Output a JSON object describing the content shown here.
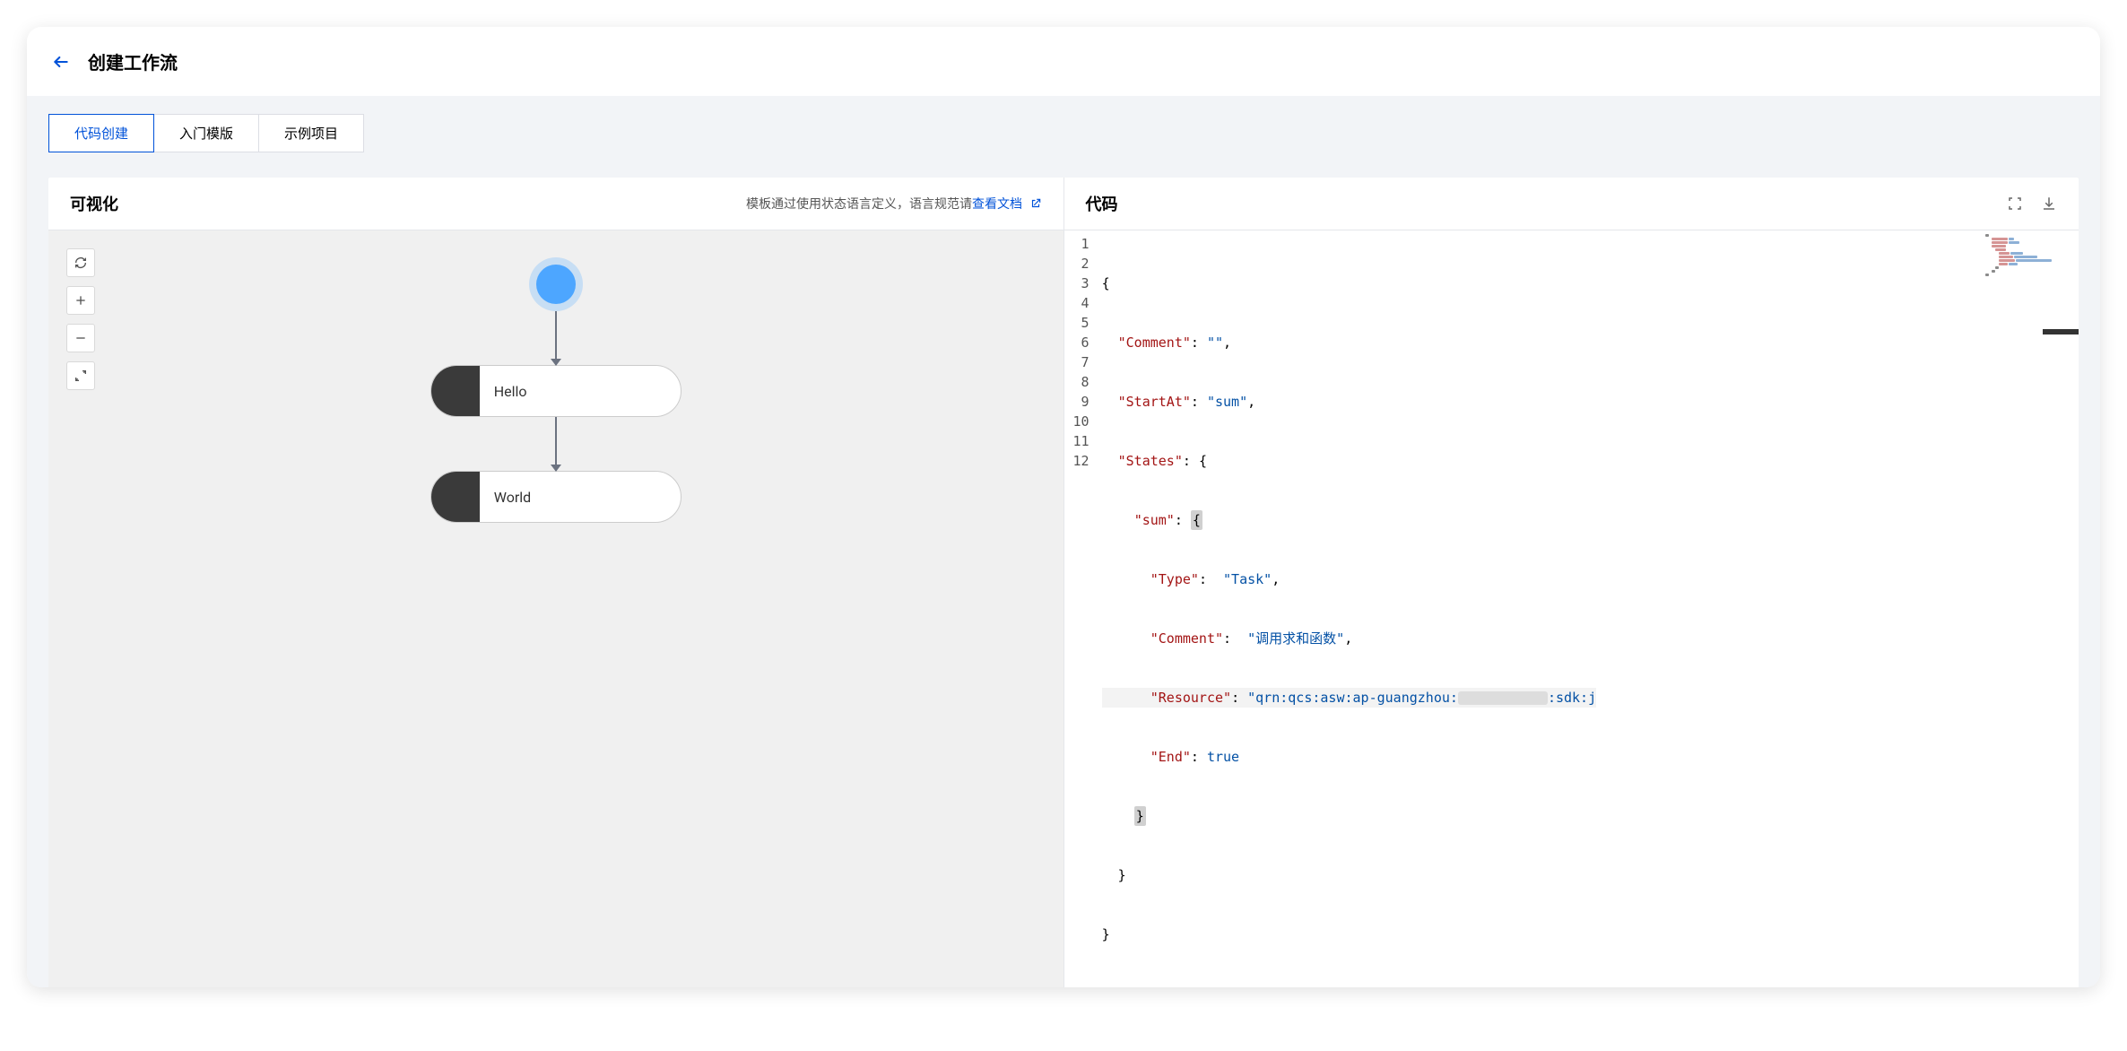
{
  "header": {
    "title": "创建工作流"
  },
  "tabs": [
    {
      "label": "代码创建",
      "active": true
    },
    {
      "label": "入门模版",
      "active": false
    },
    {
      "label": "示例项目",
      "active": false
    }
  ],
  "viz": {
    "title": "可视化",
    "note_prefix": "模板通过使用状态语言定义，语言规范请",
    "note_link": "查看文档",
    "nodes": [
      {
        "label": "Hello"
      },
      {
        "label": "World"
      }
    ]
  },
  "code": {
    "title": "代码",
    "lines": {
      "l1": "{",
      "l2_key": "\"Comment\"",
      "l2_val": "\"\"",
      "l3_key": "\"StartAt\"",
      "l3_val": "\"sum\"",
      "l4_key": "\"States\"",
      "l4_brace": "{",
      "l5_key": "\"sum\"",
      "l5_brace": "{",
      "l6_key": "\"Type\"",
      "l6_val": "\"Task\"",
      "l7_key": "\"Comment\"",
      "l7_val": "\"调用求和函数\"",
      "l8_key": "\"Resource\"",
      "l8_val_pre": "\"qrn:qcs:asw:ap-guangzhou:",
      "l8_val_post": ":sdk:j",
      "l9_key": "\"End\"",
      "l9_val": "true",
      "l10": "}",
      "l11": "}",
      "l12": "}"
    }
  }
}
